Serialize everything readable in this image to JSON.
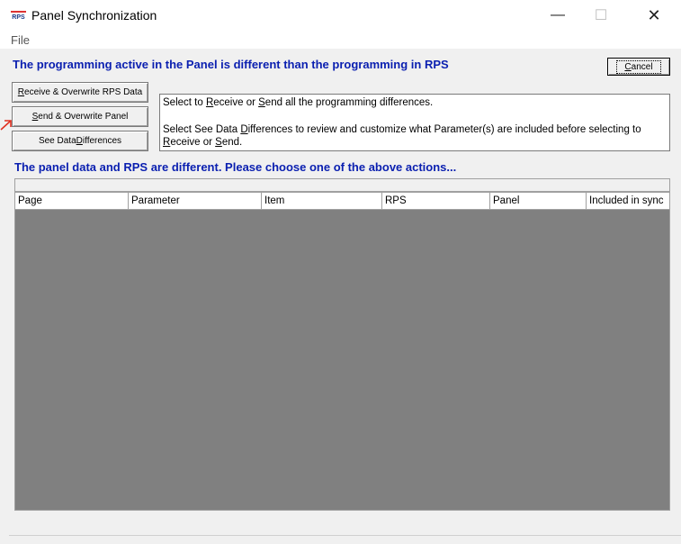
{
  "window": {
    "title": "Panel Synchronization",
    "app_icon_text": "RPS",
    "controls": {
      "minimize": "—",
      "maximize": "☐",
      "close": "✕"
    }
  },
  "menu": {
    "file": "File"
  },
  "heading": "The programming active in the Panel is different than the programming in RPS",
  "buttons": {
    "cancel": {
      "pre": "",
      "u": "C",
      "post": "ancel"
    },
    "receive": {
      "pre": "",
      "u": "R",
      "post": "eceive & Overwrite RPS Data"
    },
    "send": {
      "pre": "",
      "u": "S",
      "post": "end & Overwrite Panel"
    },
    "diff": {
      "pre": "See Data ",
      "u": "D",
      "post": "ifferences"
    }
  },
  "info": {
    "line1": {
      "a": "Select to ",
      "u1": "R",
      "b": "eceive or ",
      "u2": "S",
      "c": "end all the programming differences."
    },
    "line2": {
      "a": "Select See Data ",
      "u1": "D",
      "b": "ifferences to review and customize what Parameter(s) are included before selecting to ",
      "u2": "R",
      "c": "eceive or ",
      "u3": "S",
      "d": "end."
    }
  },
  "status": "The panel data and RPS are different. Please choose one of the above actions...",
  "table": {
    "columns": [
      "Page",
      "Parameter",
      "Item",
      "RPS",
      "Panel",
      "Included in sync"
    ],
    "rows": []
  },
  "colors": {
    "heading": "#0a1fb0",
    "grid_bg": "#808080",
    "arrow": "#e03020"
  },
  "icons": {
    "arrow": "red-arrow-icon"
  }
}
